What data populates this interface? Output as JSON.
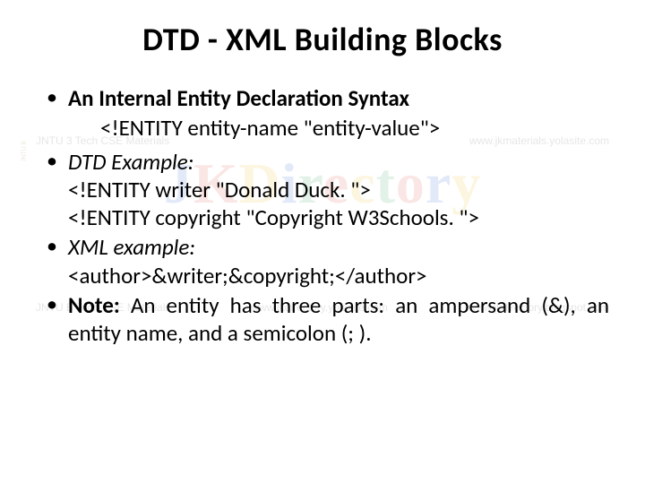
{
  "title": "DTD - XML Building Blocks",
  "bullets": {
    "b1_heading": "An Internal Entity Declaration Syntax",
    "b1_syntax": "<!ENTITY entity-name \"entity-value\">",
    "b2_label": "DTD Example:",
    "b2_line1": "<!ENTITY writer \"Donald Duck. \">",
    "b2_line2": "<!ENTITY copyright \"Copyright W3Schools. \">",
    "b3_label": "XML example:",
    "b3_line1": "<author>&writer;&copyright;</author>",
    "b4_label": "Note:",
    "b4_text": " An entity has three parts: an ampersand (&), an entity name, and a semicolon (; )."
  },
  "watermark": {
    "top_left": "JNTU 3 Tech CSE Materials",
    "top_right": "www.jkmaterials.yolasite.com",
    "logo_letters": [
      "J",
      "K",
      "D",
      "i",
      "r",
      "e",
      "c",
      "t",
      "o",
      "r",
      "y"
    ],
    "bottom_left": "JNTU B Tech CSE Materials",
    "bottom_mid": "www.jkdirectory.yolasite.com",
    "bottom_right": "www.jkdirectory.blogspot.com",
    "side": "JNTU B"
  }
}
